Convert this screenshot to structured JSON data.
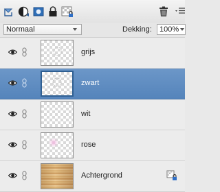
{
  "toolbar": {
    "icons": [
      "new-layer-icon",
      "new-adjustment-layer-icon",
      "add-layer-mask-icon",
      "lock-all-icon",
      "lock-transparency-icon",
      "delete-layer-icon",
      "panel-menu-icon"
    ]
  },
  "options": {
    "blend_mode": "Normaal",
    "opacity_label": "Dekking:",
    "opacity_value": "100%"
  },
  "layers": [
    {
      "name": "grijs",
      "selected": false,
      "visible": true
    },
    {
      "name": "zwart",
      "selected": true,
      "visible": true
    },
    {
      "name": "wit",
      "selected": false,
      "visible": true
    },
    {
      "name": "rose",
      "selected": false,
      "visible": true
    },
    {
      "name": "Achtergrond",
      "selected": false,
      "visible": true,
      "locked": true
    }
  ],
  "colors": {
    "selection": "#5f8ec4",
    "rose_dot": "#f2c4e4",
    "lock_badge": "#2f6fc7"
  }
}
